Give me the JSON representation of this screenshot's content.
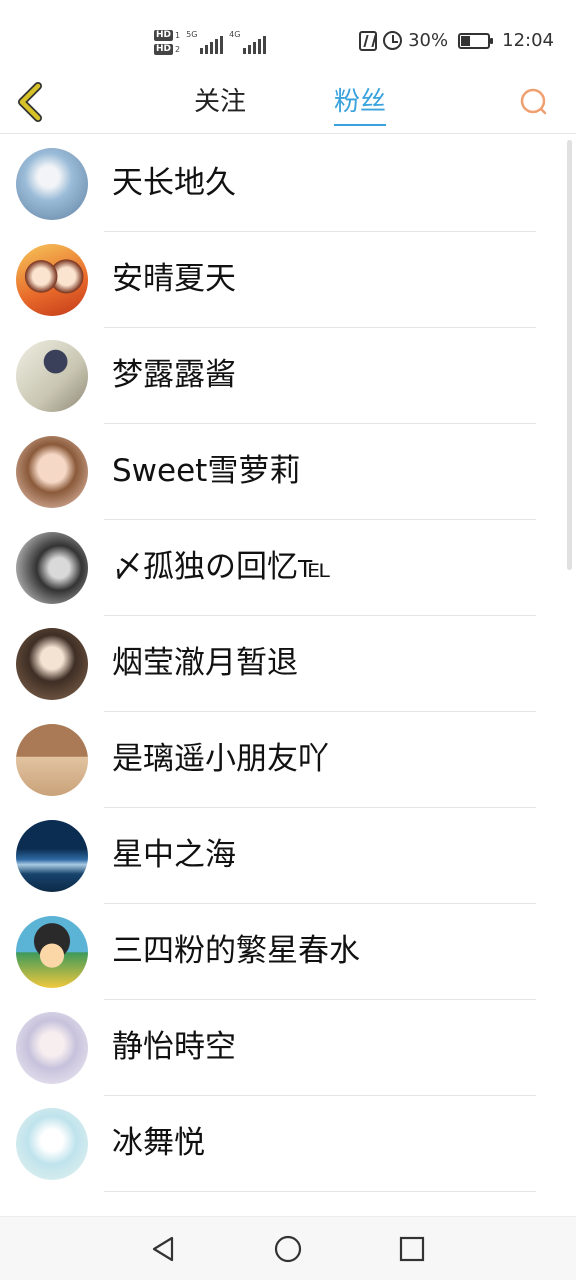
{
  "status_bar": {
    "hd_1": "HD",
    "hd_1_num": "1",
    "hd_2": "HD",
    "hd_2_num": "2",
    "net_1": "5G",
    "net_2": "4G",
    "battery": "30%",
    "time": "12:04",
    "icons": [
      "nfc-icon",
      "alarm-icon",
      "battery-icon"
    ]
  },
  "header": {
    "tabs": [
      {
        "label": "关注",
        "active": false
      },
      {
        "label": "粉丝",
        "active": true
      }
    ],
    "accent_color": "#3aa3dd",
    "back_color": "#d8c22a",
    "search_color": "#f0a070"
  },
  "fans": [
    {
      "name": "天长地久",
      "avatar_color": "#8fb6d8"
    },
    {
      "name": "安晴夏天",
      "avatar_color": "#e8863a"
    },
    {
      "name": "梦露露酱",
      "avatar_color": "#c8c8b8"
    },
    {
      "name": "Sweet雪萝莉",
      "avatar_color": "#e6b9a0"
    },
    {
      "name": "〆孤独の回忆℡",
      "avatar_color": "#555555"
    },
    {
      "name": "烟莹澈月暂退",
      "avatar_color": "#6a5a4a"
    },
    {
      "name": "是璃遥小朋友吖",
      "avatar_color": "#b58a60"
    },
    {
      "name": "星中之海",
      "avatar_color": "#1d4f7d"
    },
    {
      "name": "三四粉的繁星春水",
      "avatar_color": "#3f8f6a"
    },
    {
      "name": "静怡時空",
      "avatar_color": "#d8d6e8"
    },
    {
      "name": "冰舞悦",
      "avatar_color": "#bfe3ec"
    }
  ],
  "nav": {
    "buttons": [
      "back-nav-icon",
      "home-nav-icon",
      "recents-nav-icon"
    ]
  }
}
